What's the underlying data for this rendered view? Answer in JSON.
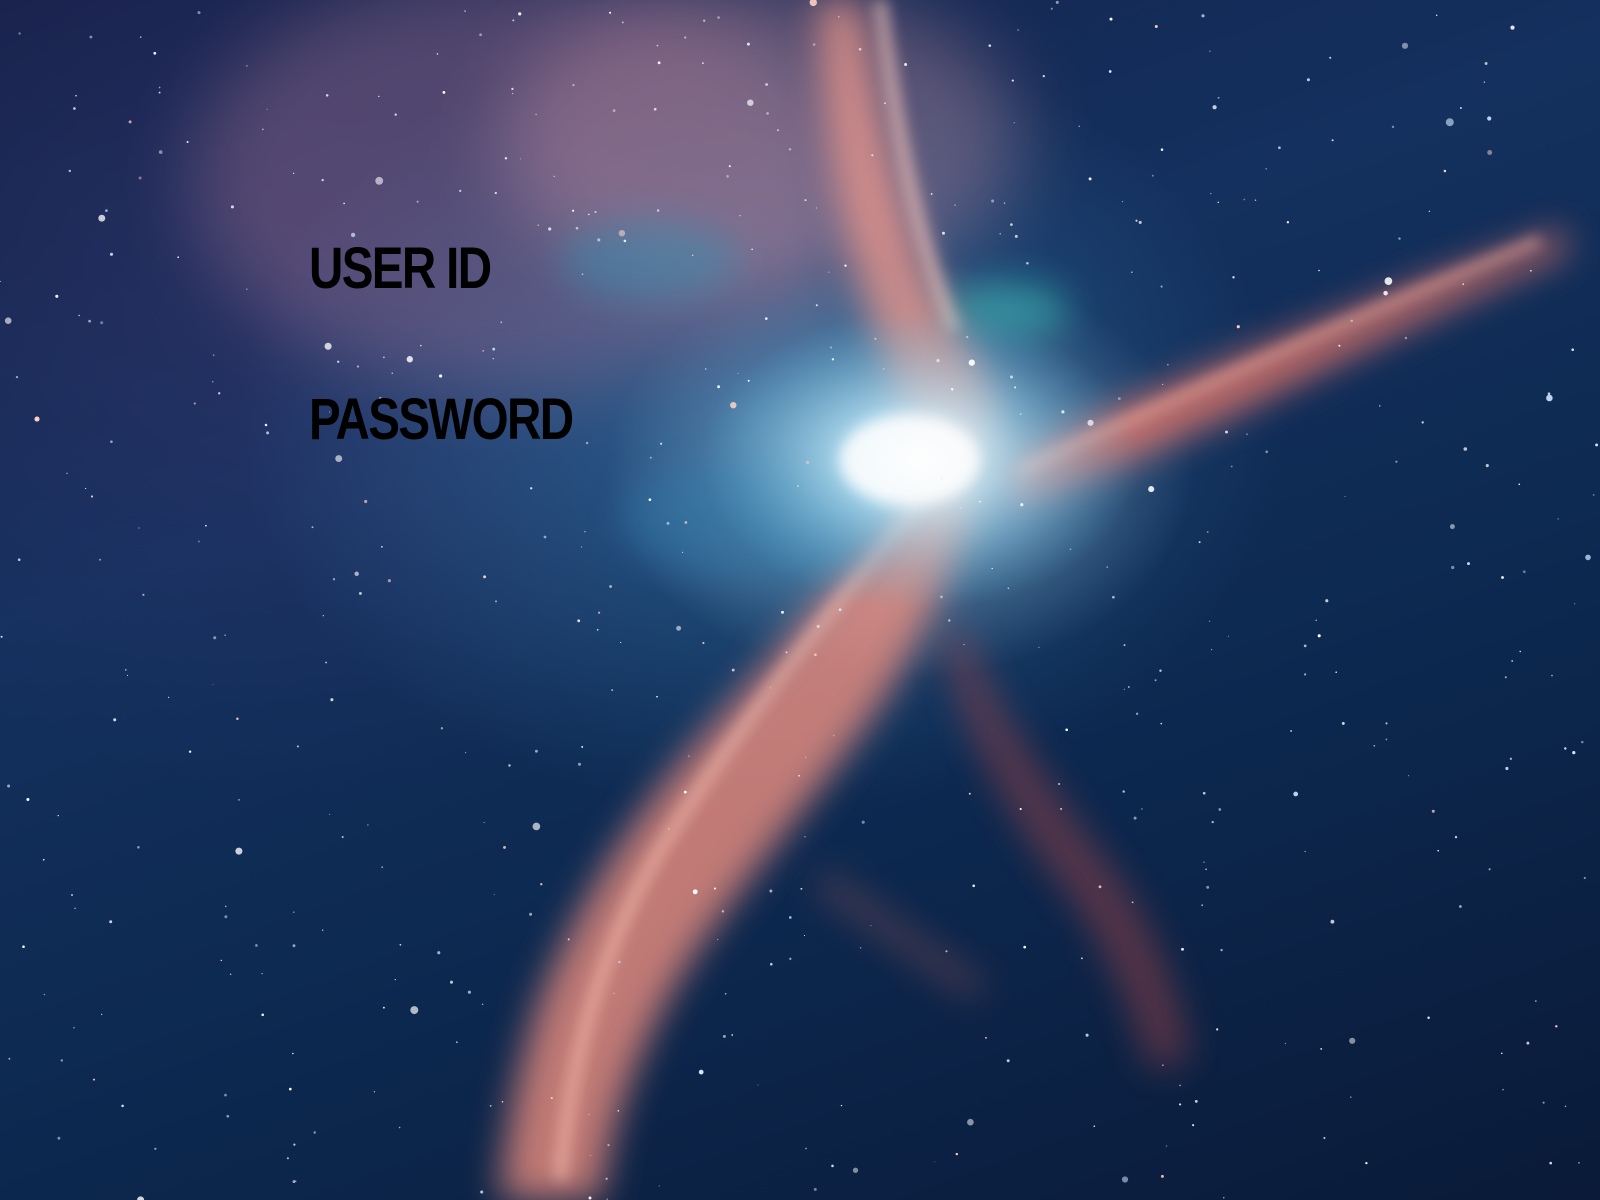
{
  "login": {
    "user_id_label": "USER ID",
    "password_label": "PASSWORD"
  },
  "background": {
    "description": "space-nebula-wallpaper",
    "colors": {
      "deep_space": "#0b1630",
      "nebula_pink": "#f08a7a",
      "nebula_glow": "#d8f4ff",
      "teal": "#2e8fb0"
    }
  }
}
